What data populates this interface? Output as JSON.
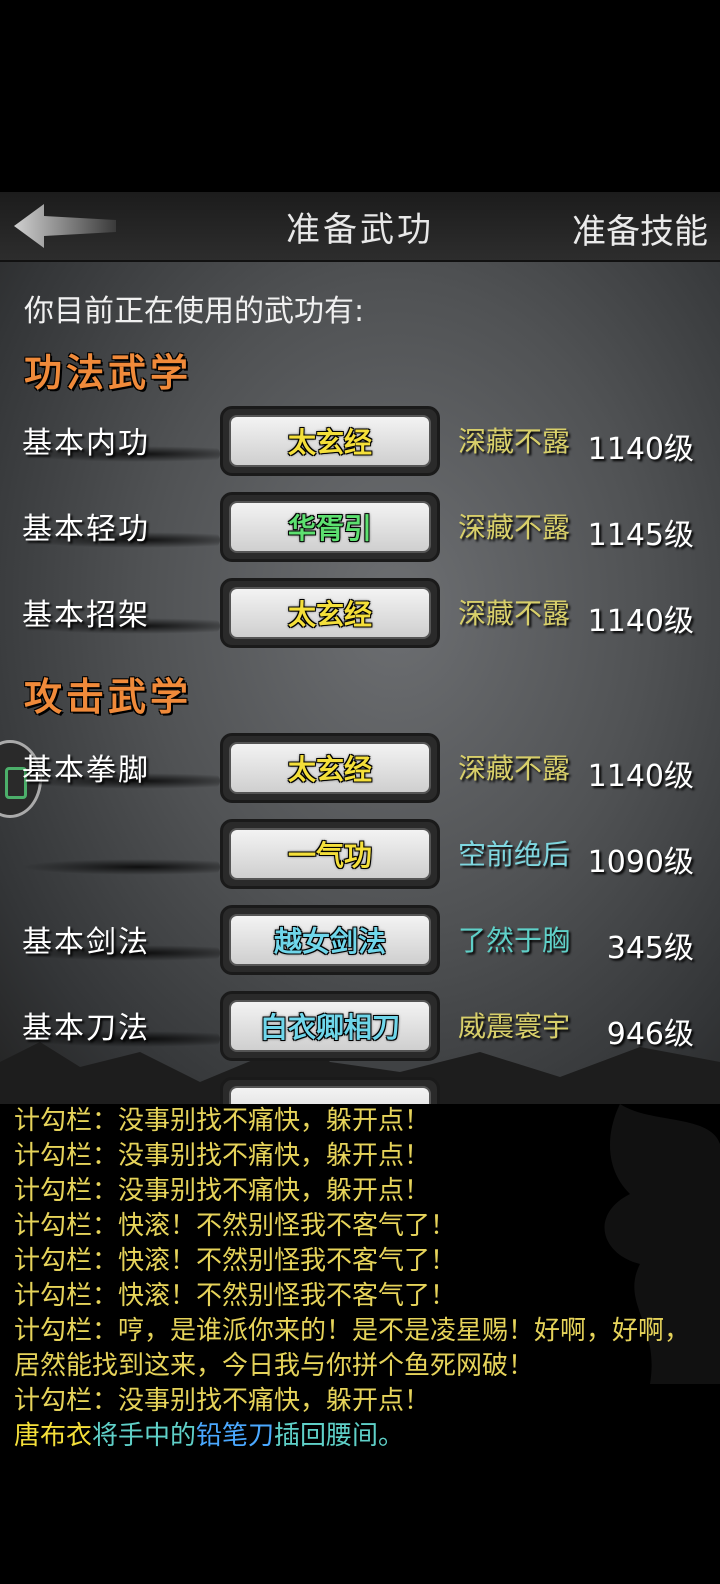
{
  "header": {
    "title": "准备武功",
    "right_tab": "准备技能"
  },
  "intro": "你目前正在使用的武功有:",
  "sections": [
    {
      "title": "功法武学"
    },
    {
      "title": "攻击武学"
    }
  ],
  "rows": [
    {
      "label": "基本内功",
      "skill": "太玄经",
      "skill_color": "#f4df3a",
      "rank": "深藏不露",
      "rank_color": "#d8cf6a",
      "level": "1140级"
    },
    {
      "label": "基本轻功",
      "skill": "华胥引",
      "skill_color": "#5de070",
      "rank": "深藏不露",
      "rank_color": "#d8cf6a",
      "level": "1145级"
    },
    {
      "label": "基本招架",
      "skill": "太玄经",
      "skill_color": "#f4df3a",
      "rank": "深藏不露",
      "rank_color": "#d8cf6a",
      "level": "1140级"
    },
    {
      "label": "基本拳脚",
      "skill": "太玄经",
      "skill_color": "#f4df3a",
      "rank": "深藏不露",
      "rank_color": "#d8cf6a",
      "level": "1140级"
    },
    {
      "label": "",
      "skill": "一气功",
      "skill_color": "#f4df3a",
      "rank": "空前绝后",
      "rank_color": "#7fd7e0",
      "level": "1090级"
    },
    {
      "label": "基本剑法",
      "skill": "越女剑法",
      "skill_color": "#6fd6ea",
      "rank": "了然于胸",
      "rank_color": "#5fd0c8",
      "level": "345级"
    },
    {
      "label": "基本刀法",
      "skill": "白衣卿相刀",
      "skill_color": "#6fd6ea",
      "rank": "威震寰宇",
      "rank_color": "#d8cf6a",
      "level": "946级"
    }
  ],
  "chat": [
    {
      "speaker": "计勾栏",
      "text": "：没事别找不痛快，躲开点！"
    },
    {
      "speaker": "计勾栏",
      "text": "：没事别找不痛快，躲开点！"
    },
    {
      "speaker": "计勾栏",
      "text": "：没事别找不痛快，躲开点！"
    },
    {
      "speaker": "计勾栏",
      "text": "：快滚！不然别怪我不客气了！"
    },
    {
      "speaker": "计勾栏",
      "text": "：快滚！不然别怪我不客气了！"
    },
    {
      "speaker": "计勾栏",
      "text": "：快滚！不然别怪我不客气了！"
    },
    {
      "speaker": "计勾栏",
      "text": "：哼，是谁派你来的！是不是凌星赐！好啊，好啊，居然能找到这来，今日我与你拼个鱼死网破！"
    },
    {
      "speaker": "计勾栏",
      "text": "：没事别找不痛快，躲开点！"
    }
  ],
  "last_message": {
    "name": "唐布衣",
    "part1": "将手中的",
    "item": "铅笔刀",
    "part2": "插回腰间。",
    "name_color": "#f4df3a",
    "text_color": "#5fd0c8",
    "item_color": "#4aa8ff"
  },
  "colors": {
    "section": "#f08a3a",
    "chat_text": "#e6d35a"
  },
  "icons": {
    "back": "back-arrow-icon",
    "side_badge": "side-badge-icon"
  }
}
